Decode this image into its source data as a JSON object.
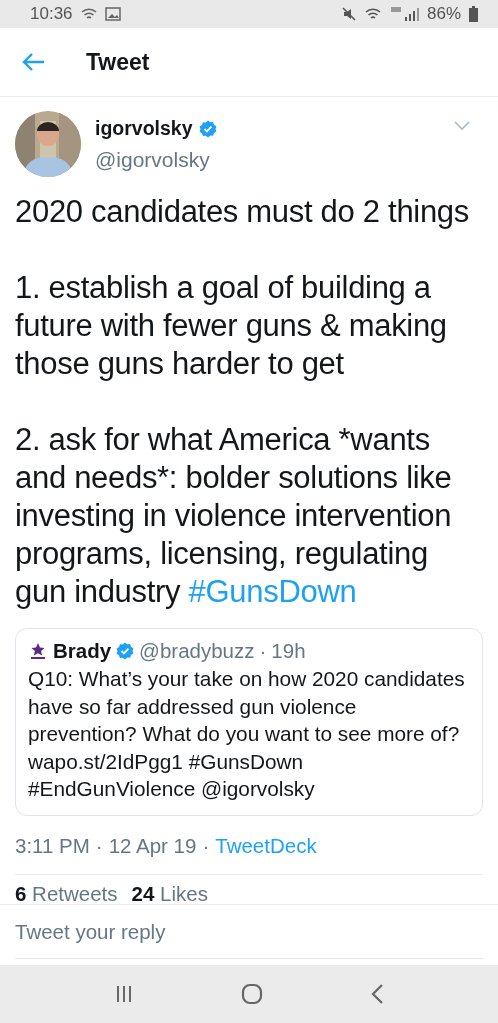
{
  "status_bar": {
    "time": "10:36",
    "battery": "86%"
  },
  "header": {
    "title": "Tweet"
  },
  "tweet": {
    "author": {
      "name": "igorvolsky",
      "verified": true,
      "handle": "@igorvolsky"
    },
    "paragraphs": [
      "2020 candidates must do 2 things",
      "1. establish a goal of building a future with fewer guns & making those guns harder to get",
      "2. ask for what America *wants and needs*: bolder solutions like investing in violence intervention programs, licensing, regulating gun industry"
    ],
    "hashtag": "#GunsDown",
    "quoted": {
      "name": "Brady",
      "verified": true,
      "handle": "@bradybuzz",
      "separator": "·",
      "time": "19h",
      "text": "Q10: What’s your take on how 2020 candidates have so far addressed gun violence prevention? What do you want to see more of? wapo.st/2IdPgg1 #GunsDown #EndGunViolence @igorvolsky"
    },
    "time": "3:11 PM",
    "separator_1": "·",
    "date": "12 Apr 19",
    "separator_2": "·",
    "source": "TweetDeck",
    "stats": [
      {
        "count": "6",
        "label": "Retweets"
      },
      {
        "count": "24",
        "label": "Likes"
      }
    ]
  },
  "reply": {
    "placeholder": "Tweet your reply"
  }
}
